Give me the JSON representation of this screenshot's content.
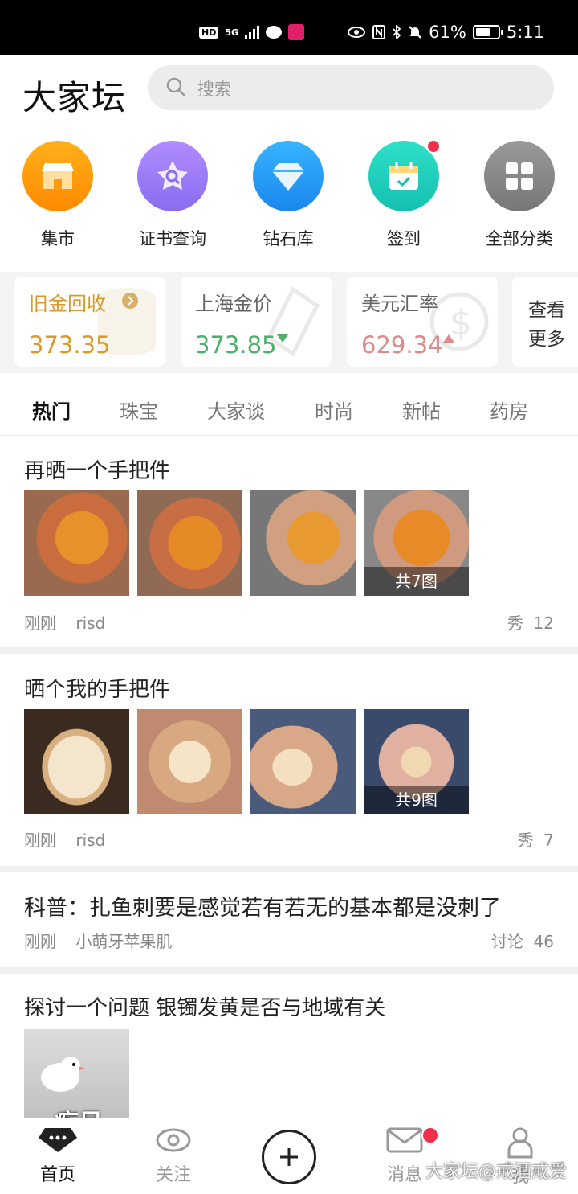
{
  "status_bar": {
    "hd": "HD",
    "network": "5G",
    "battery": "61%",
    "time": "5:11"
  },
  "header": {
    "logo": "大家坛",
    "search_placeholder": "搜索"
  },
  "quick_links": [
    {
      "label": "集市",
      "icon": "market-icon",
      "color": "#ff9a10"
    },
    {
      "label": "证书查询",
      "icon": "certificate-search-icon",
      "color": "#9a7cf2"
    },
    {
      "label": "钻石库",
      "icon": "diamond-icon",
      "color": "#2a9ef5"
    },
    {
      "label": "签到",
      "icon": "calendar-checkin-icon",
      "color": "#1fcfbf"
    },
    {
      "label": "全部分类",
      "icon": "grid-categories-icon",
      "color": "#8a8a8a"
    }
  ],
  "prices": [
    {
      "title": "旧金回收",
      "value": "373.35",
      "title_color": "#d99a2b",
      "value_color": "#d99a2b",
      "trend": ""
    },
    {
      "title": "上海金价",
      "value": "373.85",
      "title_color": "#666666",
      "value_color": "#4caf6a",
      "trend": "down"
    },
    {
      "title": "美元汇率",
      "value": "629.34",
      "title_color": "#666666",
      "value_color": "#d98a8a",
      "trend": "up"
    }
  ],
  "more_card": {
    "line1": "查看",
    "line2": "更多"
  },
  "tabs": [
    "热门",
    "珠宝",
    "大家谈",
    "时尚",
    "新帖",
    "药房"
  ],
  "posts": [
    {
      "title": "再晒一个手把件",
      "time": "刚刚",
      "author": "risd",
      "category": "秀",
      "count": "12",
      "image_count_label": "共7图"
    },
    {
      "title": "晒个我的手把件",
      "time": "刚刚",
      "author": "risd",
      "category": "秀",
      "count": "7",
      "image_count_label": "共9图"
    },
    {
      "title": "科普：扎鱼刺要是感觉若有若无的基本都是没刺了",
      "time": "刚刚",
      "author": "小萌牙苹果肌",
      "category": "讨论",
      "count": "46"
    },
    {
      "title": "探讨一个问题 银镯发黄是否与地域有关",
      "image_text": "痴呆"
    }
  ],
  "bottom_nav": {
    "home": "首页",
    "follow": "关注",
    "messages": "消息",
    "me": "我",
    "watermark": "大家坛@戒酒戒爱"
  }
}
